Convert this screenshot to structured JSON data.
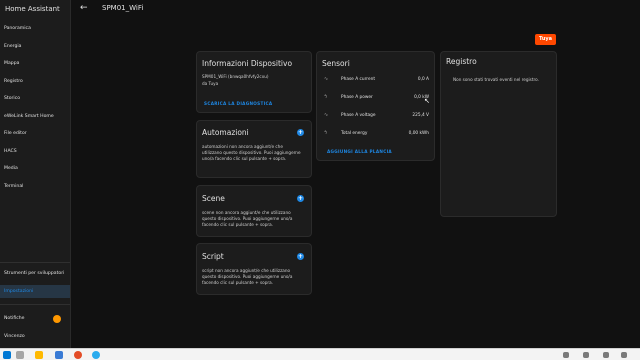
{
  "sidebar": {
    "title": "Home Assistant",
    "items": [
      {
        "label": "Panoramica"
      },
      {
        "label": "Energia"
      },
      {
        "label": "Mappa"
      },
      {
        "label": "Registro"
      },
      {
        "label": "Storico"
      },
      {
        "label": "eWeLink Smart Home"
      },
      {
        "label": "File editor"
      },
      {
        "label": "HACS"
      },
      {
        "label": "Media"
      },
      {
        "label": "Terminal"
      }
    ],
    "dev_tools": "Strumenti per sviluppatori",
    "settings": "Impostazioni",
    "notifications": "Notifiche",
    "user": "Vincenzo"
  },
  "header": {
    "back_icon": "arrow-left-icon",
    "title": "SPM01_WiFi"
  },
  "brand": {
    "label": "Tuya",
    "color": "#ff4800"
  },
  "device_info": {
    "title": "Informazioni Dispositivo",
    "model": "SPM01_WiFi (bnwqa0hfvfy2cxu)",
    "manufacturer": "da Tuya",
    "download_link": "SCARICA LA DIAGNOSTICA"
  },
  "automations": {
    "title": "Automazioni",
    "text": "automazioni non ancora aggiunt/e che utilizzano questo dispositivo. Puoi aggiungerne uno/a facendo clic sul pulsante + sopra."
  },
  "scenes": {
    "title": "Scene",
    "text": "scene non ancora aggiunt/e che utilizzano questo dispositivo. Puoi aggiungerne uno/a facendo clic sul pulsante + sopra."
  },
  "scripts": {
    "title": "Script",
    "text": "script non ancora aggiunt/e che utilizzano questo dispositivo. Puoi aggiungerne uno/a facendo clic sul pulsante + sopra."
  },
  "sensors": {
    "title": "Sensori",
    "rows": [
      {
        "icon": "sine-wave-icon",
        "name": "Phase A current",
        "value": "0,0 A"
      },
      {
        "icon": "lightning-icon",
        "name": "Phase A power",
        "value": "0,0 kW"
      },
      {
        "icon": "sine-wave-icon",
        "name": "Phase A voltage",
        "value": "225,4 V"
      },
      {
        "icon": "lightning-icon",
        "name": "Total energy",
        "value": "0,00 kWh"
      }
    ],
    "add_link": "AGGIUNGI ALLA PLANCIA"
  },
  "logbook": {
    "title": "Registro",
    "empty_text": "Non sono stati trovati eventi nel registro."
  },
  "colors": {
    "accent": "#1e88e5",
    "badge": "#ff9800"
  }
}
